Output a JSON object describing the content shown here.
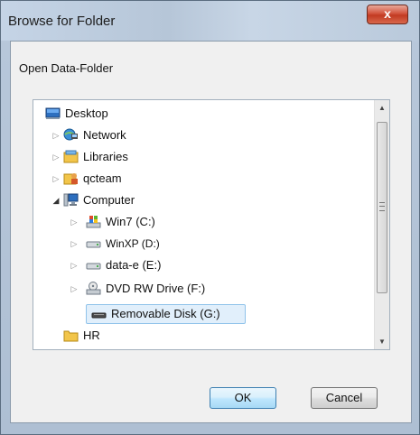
{
  "dialog": {
    "title": "Browse for Folder",
    "close_label": "x",
    "description": "Open Data-Folder"
  },
  "tree": {
    "items": [
      {
        "label": "Desktop",
        "icon": "desktop-icon",
        "expander": "none"
      },
      {
        "label": "Network",
        "icon": "network-icon",
        "expander": "collapsed"
      },
      {
        "label": "Libraries",
        "icon": "libraries-icon",
        "expander": "collapsed"
      },
      {
        "label": "qcteam",
        "icon": "user-folder-icon",
        "expander": "collapsed"
      },
      {
        "label": "Computer",
        "icon": "computer-icon",
        "expander": "expanded"
      },
      {
        "label": "Win7 (C:)",
        "icon": "windows-drive-icon",
        "expander": "collapsed"
      },
      {
        "label": "WinXP (D:)",
        "icon": "hard-drive-icon",
        "expander": "collapsed"
      },
      {
        "label": "data-e (E:)",
        "icon": "hard-drive-icon",
        "expander": "collapsed"
      },
      {
        "label": "DVD RW Drive (F:)",
        "icon": "dvd-drive-icon",
        "expander": "collapsed"
      },
      {
        "label": "Removable Disk (G:)",
        "icon": "removable-disk-icon",
        "expander": "none",
        "selected": true
      },
      {
        "label": "HR",
        "icon": "folder-icon",
        "expander": "none"
      }
    ]
  },
  "buttons": {
    "ok": "OK",
    "cancel": "Cancel"
  },
  "colors": {
    "selection_fill": "#e1effb",
    "selection_border": "#90c3ea",
    "close_button": "#c23a22"
  }
}
